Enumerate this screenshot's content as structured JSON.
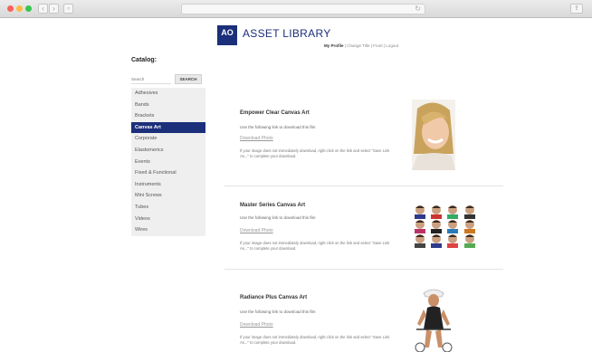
{
  "header": {
    "logo_text": "AO",
    "site_title": "ASSET LIBRARY",
    "my_profile": "My Profile",
    "top_links_rest": "| Change Title | Front | Logout"
  },
  "sidebar": {
    "catalog_label": "Catalog:",
    "search_placeholder": "Search",
    "search_button": "SEARCH",
    "items": [
      {
        "label": "Adhesives"
      },
      {
        "label": "Bands"
      },
      {
        "label": "Brackets"
      },
      {
        "label": "Canvas Art"
      },
      {
        "label": "Corporate"
      },
      {
        "label": "Elastomerics"
      },
      {
        "label": "Events"
      },
      {
        "label": "Fixed & Functional"
      },
      {
        "label": "Instruments"
      },
      {
        "label": "Mini Screws"
      },
      {
        "label": "Tubes"
      },
      {
        "label": "Videos"
      },
      {
        "label": "Wires"
      }
    ],
    "active_item": "Canvas Art"
  },
  "main": {
    "items": [
      {
        "title": "Empower Clear Canvas Art",
        "desc": "Use the following link to download this file:",
        "link": "Download Photo",
        "note": "If your image does not immediately download, right click on the link and select \"Save Link As...\" to complete your download."
      },
      {
        "title": "Master Series Canvas Art",
        "desc": "Use the following link to download this file:",
        "link": "Download Photo",
        "note": "If your image does not immediately download, right click on the link and select \"Save Link As...\" to complete your download."
      },
      {
        "title": "Radiance Plus Canvas Art",
        "desc": "Use the following link to download this file:",
        "link": "Download Photo",
        "note": "If your image does not immediately download, right click on the link and select \"Save Link As...\" to complete your download."
      }
    ]
  },
  "colors": {
    "brand": "#1b2f7a",
    "sidebar_bg": "#efefef"
  },
  "icons": {
    "close": "close-window-icon",
    "minimize": "minimize-window-icon",
    "zoom": "zoom-window-icon"
  }
}
